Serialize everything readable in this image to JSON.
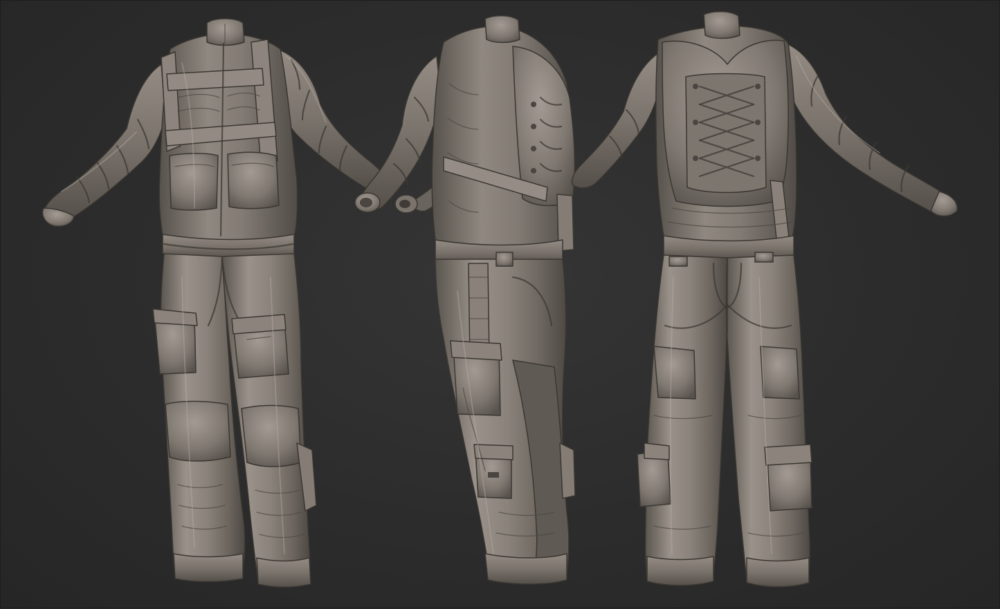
{
  "scene": {
    "subject": "sculpted-flight-suit",
    "views": [
      "front-three-quarter",
      "side",
      "back"
    ],
    "colors": {
      "background": "#2b2b2b",
      "material_base": "#7c7670",
      "material_light": "#aaa29a",
      "material_dark": "#4a4540",
      "seam": "#3c3833"
    }
  }
}
